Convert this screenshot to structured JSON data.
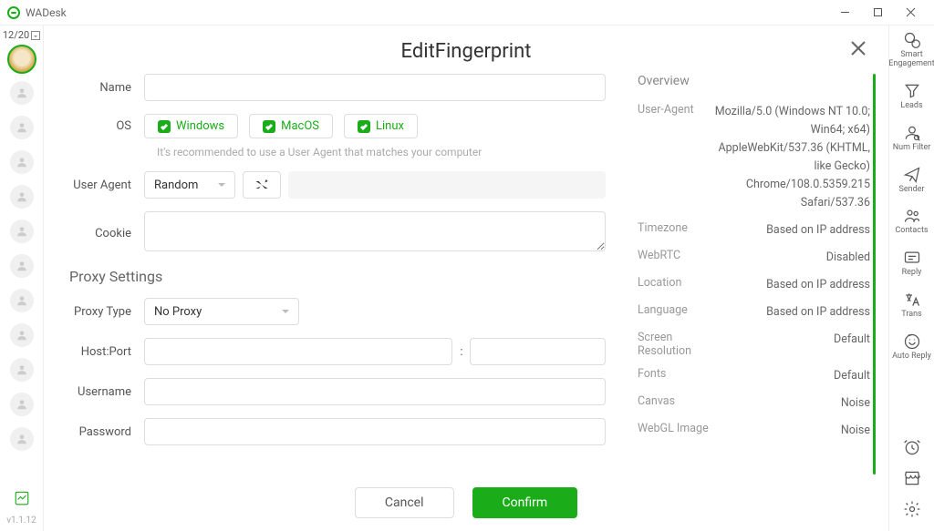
{
  "app": {
    "name": "WADesk",
    "version": "v1.1.12",
    "counter": "12/20"
  },
  "modal": {
    "title": "EditFingerprint",
    "form": {
      "name_label": "Name",
      "os_label": "OS",
      "os_options": {
        "windows": "Windows",
        "macos": "MacOS",
        "linux": "Linux"
      },
      "os_hint": "It's recommended to use a User Agent that matches your computer",
      "ua_label": "User Agent",
      "ua_select_value": "Random",
      "cookie_label": "Cookie",
      "proxy_section": "Proxy Settings",
      "proxy_type_label": "Proxy Type",
      "proxy_type_value": "No Proxy",
      "hostport_label": "Host:Port",
      "hostport_sep": ":",
      "username_label": "Username",
      "password_label": "Password"
    },
    "overview": {
      "title": "Overview",
      "rows": [
        {
          "label": "User-Agent",
          "value": "Mozilla/5.0 (Windows NT 10.0; Win64; x64) AppleWebKit/537.36 (KHTML, like Gecko) Chrome/108.0.5359.215 Safari/537.36"
        },
        {
          "label": "Timezone",
          "value": "Based on IP address"
        },
        {
          "label": "WebRTC",
          "value": "Disabled"
        },
        {
          "label": "Location",
          "value": "Based on IP address"
        },
        {
          "label": "Language",
          "value": "Based on IP address"
        },
        {
          "label": "Screen Resolution",
          "value": "Default"
        },
        {
          "label": "Fonts",
          "value": "Default"
        },
        {
          "label": "Canvas",
          "value": "Noise"
        },
        {
          "label": "WebGL Image",
          "value": "Noise"
        }
      ]
    },
    "footer": {
      "cancel": "Cancel",
      "confirm": "Confirm"
    }
  },
  "right_tools": [
    {
      "key": "smart",
      "label": "Smart Engagement"
    },
    {
      "key": "leads",
      "label": "Leads"
    },
    {
      "key": "numfilter",
      "label": "Num Filter"
    },
    {
      "key": "sender",
      "label": "Sender"
    },
    {
      "key": "contacts",
      "label": "Contacts"
    },
    {
      "key": "reply",
      "label": "Reply"
    },
    {
      "key": "trans",
      "label": "Trans"
    },
    {
      "key": "autoreply",
      "label": "Auto Reply"
    }
  ]
}
